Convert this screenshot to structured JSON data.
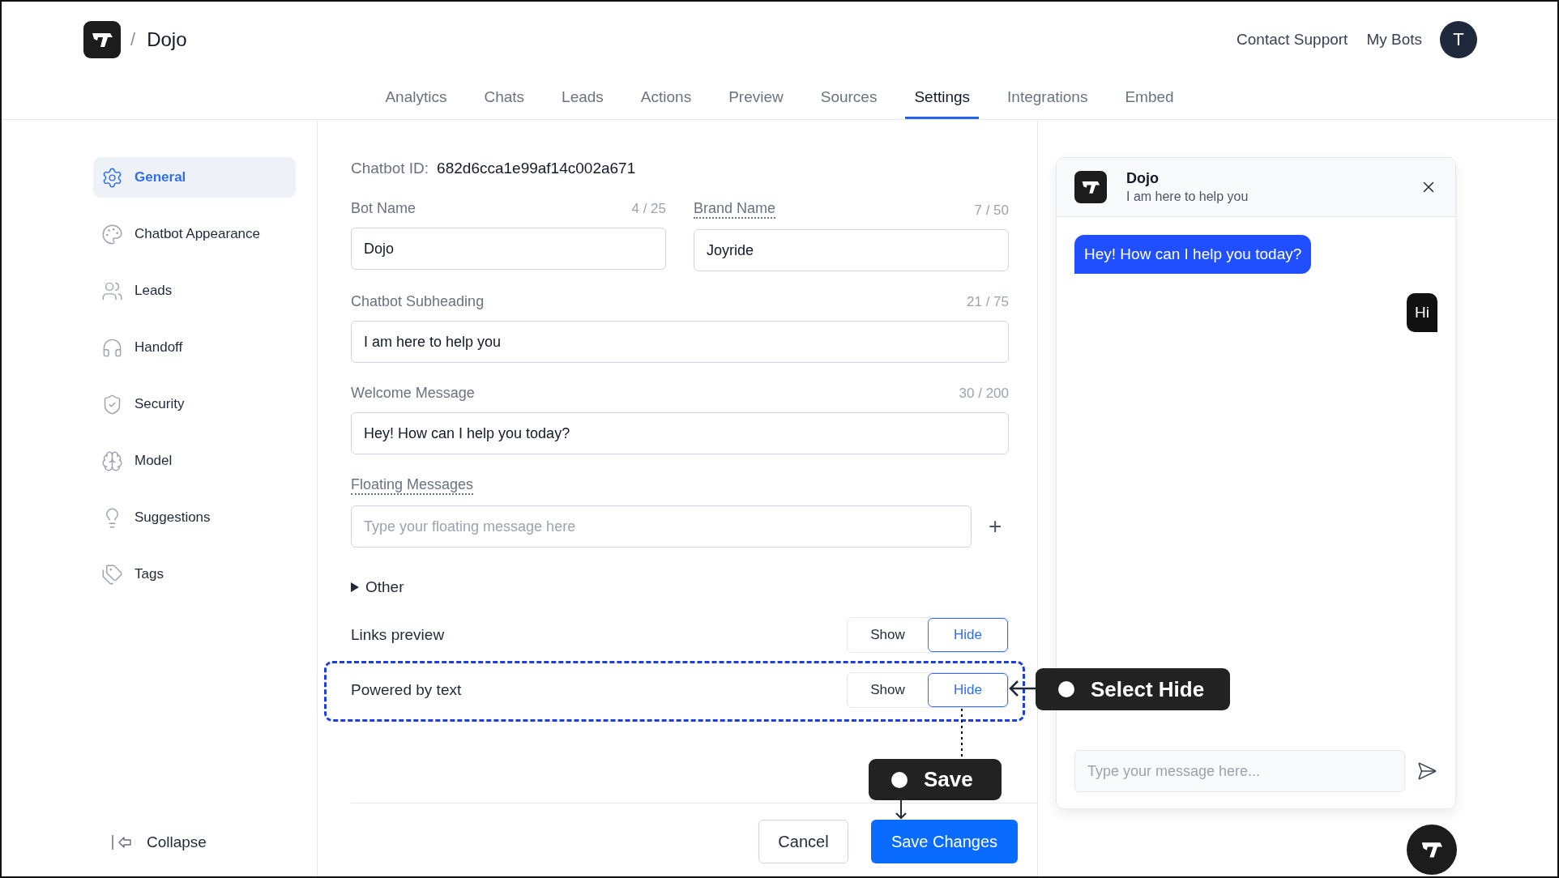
{
  "header": {
    "brand": "Dojo",
    "separator": "/",
    "links": [
      "Contact Support",
      "My Bots"
    ],
    "avatar": "T"
  },
  "tabs": [
    {
      "label": "Analytics",
      "selected": false
    },
    {
      "label": "Chats",
      "selected": false
    },
    {
      "label": "Leads",
      "selected": false
    },
    {
      "label": "Actions",
      "selected": false
    },
    {
      "label": "Preview",
      "selected": false
    },
    {
      "label": "Sources",
      "selected": false
    },
    {
      "label": "Settings",
      "selected": true
    },
    {
      "label": "Integrations",
      "selected": false
    },
    {
      "label": "Embed",
      "selected": false
    }
  ],
  "sidebar": {
    "items": [
      {
        "label": "General",
        "selected": true
      },
      {
        "label": "Chatbot Appearance",
        "selected": false
      },
      {
        "label": "Leads",
        "selected": false
      },
      {
        "label": "Handoff",
        "selected": false
      },
      {
        "label": "Security",
        "selected": false
      },
      {
        "label": "Model",
        "selected": false
      },
      {
        "label": "Suggestions",
        "selected": false
      },
      {
        "label": "Tags",
        "selected": false
      }
    ],
    "collapse": "Collapse"
  },
  "form": {
    "chatbot_id": {
      "label": "Chatbot ID:",
      "value": "682d6cca1e99af14c002a671"
    },
    "rows": [
      {
        "fields": [
          {
            "label": "Bot Name",
            "hint": false,
            "count": "4 / 25",
            "value": "Dojo"
          },
          {
            "label": "Brand Name",
            "hint": true,
            "count": "7 / 50",
            "value": "Joyride"
          }
        ]
      },
      {
        "fields": [
          {
            "label": "Chatbot Subheading",
            "hint": false,
            "count": "21 / 75",
            "value": "I am here to help you"
          }
        ]
      },
      {
        "fields": [
          {
            "label": "Welcome Message",
            "hint": false,
            "count": "30 / 200",
            "value": "Hey! How can I help you today?"
          }
        ]
      }
    ],
    "floating": {
      "label": "Floating Messages",
      "hint": true,
      "placeholder": "Type your floating message here",
      "add": "+"
    },
    "other": {
      "label": "Other",
      "expanded": false
    },
    "toggles": [
      {
        "label": "Links preview",
        "highlighted": false,
        "options": [
          {
            "label": "Show",
            "selected": false
          },
          {
            "label": "Hide",
            "selected": true
          }
        ]
      },
      {
        "label": "Powered by text",
        "highlighted": true,
        "options": [
          {
            "label": "Show",
            "selected": false
          },
          {
            "label": "Hide",
            "selected": true
          }
        ]
      }
    ],
    "cancel": "Cancel",
    "save": "Save Changes"
  },
  "annotations": [
    {
      "text": "Select Hide"
    },
    {
      "text": "Save"
    }
  ],
  "chat_preview": {
    "title": "Dojo",
    "subtitle": "I am here to help you",
    "messages": [
      {
        "kind": "bot",
        "text": "Hey! How can I help you today?"
      },
      {
        "kind": "user",
        "text": "Hi"
      }
    ],
    "input_placeholder": "Type your message here..."
  }
}
